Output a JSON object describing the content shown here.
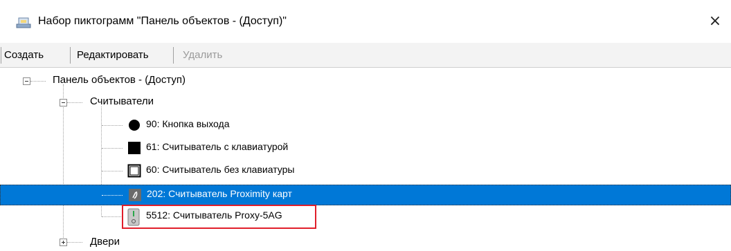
{
  "window": {
    "title": "Набор пиктограмм \"Панель объектов - (Доступ)\"",
    "close_glyph": "×"
  },
  "toolbar": {
    "create_label": "Создать",
    "edit_label": "Редактировать",
    "delete_label": "Удалить"
  },
  "tree": {
    "root": {
      "label": "Панель объектов - (Доступ)",
      "expanded": true
    },
    "readers": {
      "label": "Считыватели",
      "expanded": true
    },
    "items": [
      {
        "label": "90: Кнопка выхода",
        "icon": "filled-circle-icon"
      },
      {
        "label": "61: Считыватель с клавиатурой",
        "icon": "filled-square-icon"
      },
      {
        "label": "60: Считыватель без клавиатуры",
        "icon": "empty-square-icon"
      },
      {
        "label": "202: Считыватель Proximity карт",
        "icon": "proximity-reader-icon",
        "selected": true
      },
      {
        "label": "5512: Считыватель Proxy-5AG",
        "icon": "proxy-reader-icon",
        "highlighted": true
      }
    ],
    "doors": {
      "label": "Двери",
      "expanded": false
    }
  },
  "colors": {
    "selection": "#0078d7",
    "highlight_border": "#e01e2a",
    "toolbar_bg": "#f3f3f3"
  }
}
